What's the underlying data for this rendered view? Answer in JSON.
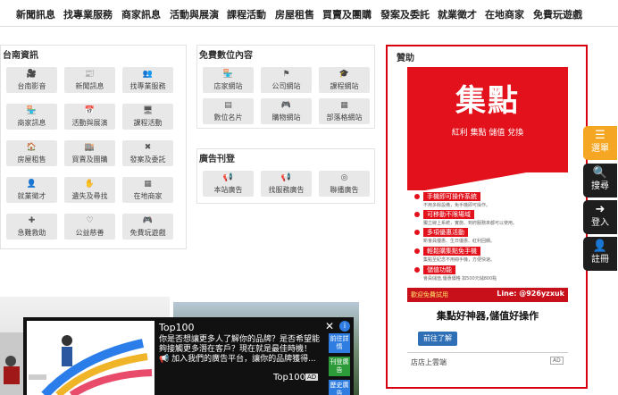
{
  "topnav": [
    "新聞訊息",
    "找專業服務",
    "商家訊息",
    "活動與展演",
    "課程活動",
    "房屋租售",
    "買賣及團購",
    "發案及委託",
    "就業徵才",
    "在地商家",
    "免費玩遊戲"
  ],
  "tainan": {
    "title": "台南資訊",
    "tiles": [
      {
        "label": "台南影音",
        "icon": "video-icon",
        "glyph": "🎥"
      },
      {
        "label": "新聞訊息",
        "icon": "newspaper-icon",
        "glyph": "📰"
      },
      {
        "label": "找專業服務",
        "icon": "people-icon",
        "glyph": "👥"
      },
      {
        "label": "商家訊息",
        "icon": "store-icon",
        "glyph": "🏪"
      },
      {
        "label": "活動與展演",
        "icon": "calendar-icon",
        "glyph": "📅"
      },
      {
        "label": "課程活動",
        "icon": "screen-icon",
        "glyph": "🖥"
      },
      {
        "label": "房屋租售",
        "icon": "house-icon",
        "glyph": "🏠"
      },
      {
        "label": "買賣及團購",
        "icon": "shop-icon",
        "glyph": "🏬"
      },
      {
        "label": "發案及委託",
        "icon": "tools-icon",
        "glyph": "✖"
      },
      {
        "label": "就業徵才",
        "icon": "person-icon",
        "glyph": "👤"
      },
      {
        "label": "遺失及尋找",
        "icon": "hand-icon",
        "glyph": "✋"
      },
      {
        "label": "在地商家",
        "icon": "grid-icon",
        "glyph": "▦"
      },
      {
        "label": "急難救助",
        "icon": "aid-icon",
        "glyph": "✚"
      },
      {
        "label": "公益慈善",
        "icon": "heart-icon",
        "glyph": "♡"
      },
      {
        "label": "免費玩遊戲",
        "icon": "gamepad-icon",
        "glyph": "🎮"
      }
    ]
  },
  "digital": {
    "title": "免費數位內容",
    "tiles": [
      {
        "label": "店家網站",
        "icon": "store-icon",
        "glyph": "🏪"
      },
      {
        "label": "公司網站",
        "icon": "flag-icon",
        "glyph": "⚑"
      },
      {
        "label": "課程網站",
        "icon": "graduation-icon",
        "glyph": "🎓"
      },
      {
        "label": "數位名片",
        "icon": "card-icon",
        "glyph": "▤"
      },
      {
        "label": "購物網站",
        "icon": "gamepad-icon",
        "glyph": "🎮"
      },
      {
        "label": "部落格網站",
        "icon": "blog-icon",
        "glyph": "▦"
      }
    ]
  },
  "ads": {
    "title": "廣告刊登",
    "tiles": [
      {
        "label": "本站廣告",
        "icon": "megaphone-icon",
        "glyph": "📢"
      },
      {
        "label": "找服務廣告",
        "icon": "megaphone-icon",
        "glyph": "📢"
      },
      {
        "label": "聯播廣告",
        "icon": "target-icon",
        "glyph": "◎"
      }
    ]
  },
  "sponsor": {
    "title": "贊助",
    "ad": {
      "big_text": "集點",
      "sub_text": "紅利 集點 儲值 兌換",
      "features": [
        {
          "title": "手機即可操作系統",
          "desc": "不用多餘設備，免手機即可操作。"
        },
        {
          "title": "可移動不限場域",
          "desc": "獨立線上系統，實施、到府服務來都可以使用。"
        },
        {
          "title": "多項優惠活動",
          "desc": "新會員優惠、生日優惠、紅利回饋。"
        },
        {
          "title": "輕鬆購集點免手機",
          "desc": "集點至紀念不用冊手機，方便快速。"
        },
        {
          "title": "儲值功能",
          "desc": "會員儲值,優惠價格 如500元儲800點"
        }
      ],
      "bottom_left": "歡迎免費試用",
      "bottom_right": "Line: @926yzxuk",
      "headline": "集點好神器,儲值好操作",
      "button": "前往了解",
      "footer": "店店上雲端",
      "badge": "AD"
    }
  },
  "sidemenu": [
    {
      "label": "選單",
      "icon": "menu-icon",
      "glyph": "☰",
      "color": "#f5a623"
    },
    {
      "label": "搜尋",
      "icon": "search-icon",
      "glyph": "🔍",
      "color": "#1e1e1e"
    },
    {
      "label": "登入",
      "icon": "login-icon",
      "glyph": "➜",
      "color": "#1e1e1e"
    },
    {
      "label": "註冊",
      "icon": "add-user-icon",
      "glyph": "👤",
      "color": "#1e1e1e"
    }
  ],
  "popup": {
    "title": "Top100",
    "text": "你是否想讓更多人了解你的品牌？是否希望能夠接觸更多潛在客戶？現在就是最佳時機！📢 加入我們的廣告平台，讓你的品牌獲得...",
    "brand": "Top100",
    "ad_label": "AD",
    "tags": [
      {
        "label": "前往詳情",
        "color": "#2f7de1"
      },
      {
        "label": "刊登廣告",
        "color": "#2e9b3a"
      },
      {
        "label": "歷史廣告",
        "color": "#2f7de1"
      }
    ]
  }
}
